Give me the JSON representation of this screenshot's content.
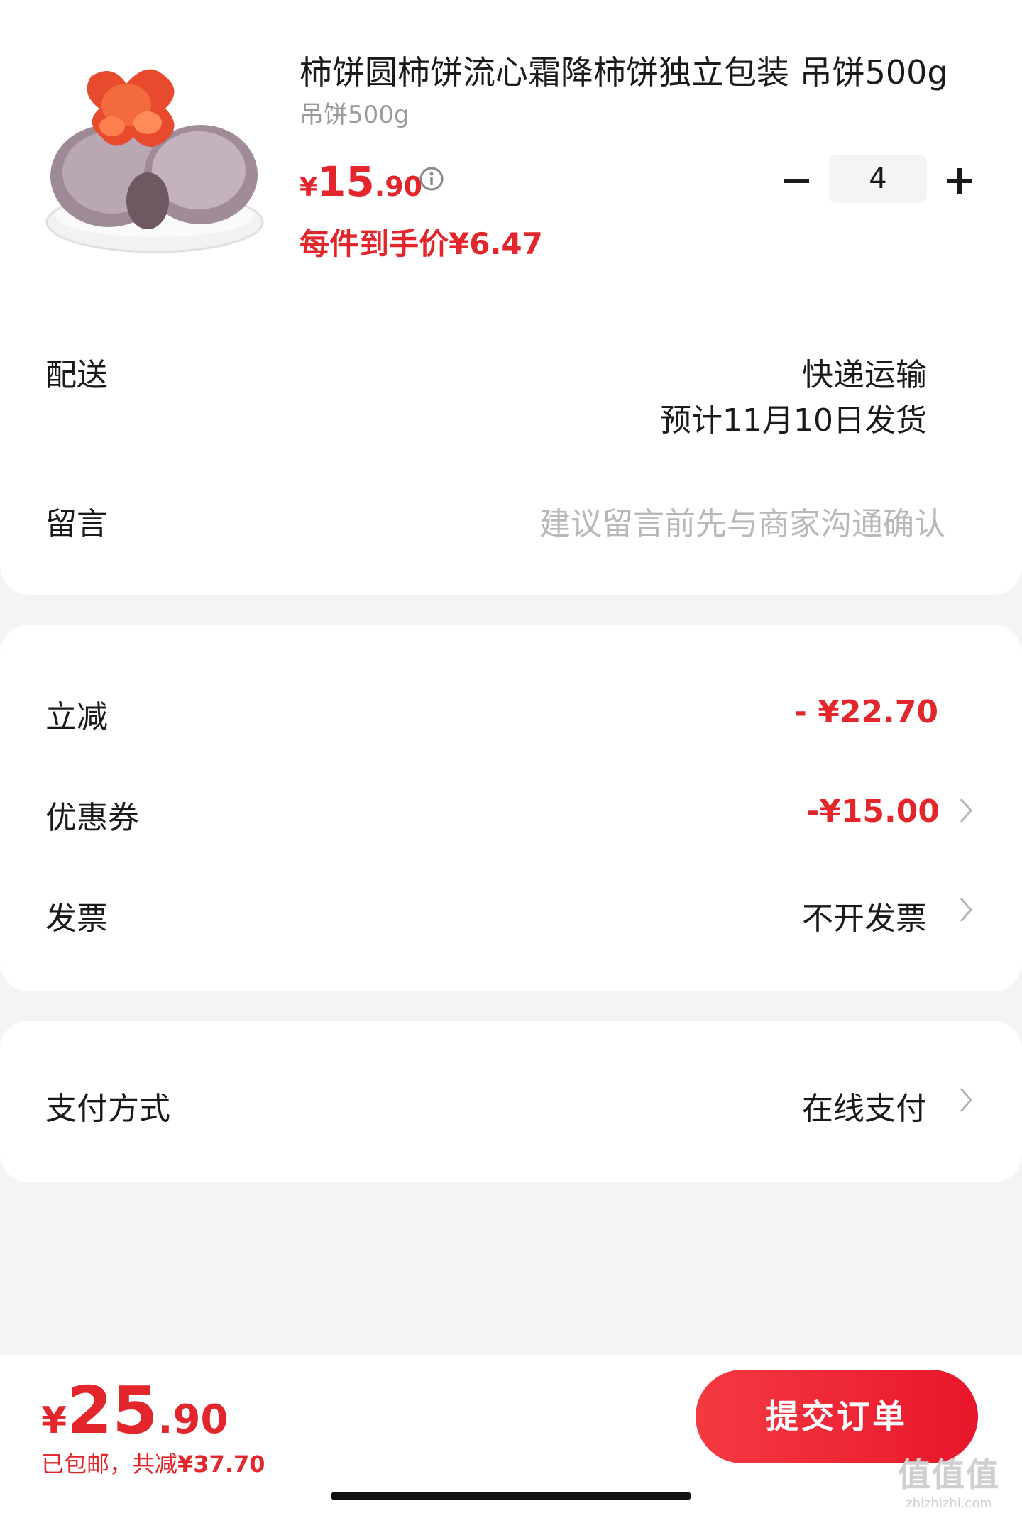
{
  "product": {
    "title": "柿饼圆柿饼流心霜降柿饼独立包装 吊饼500g",
    "spec": "吊饼500g",
    "price_yen": "¥",
    "price_int": "15",
    "price_dec": ".90",
    "unit_price_label": "每件到手价¥6.47",
    "quantity": "4"
  },
  "delivery": {
    "label": "配送",
    "method": "快递运输",
    "eta": "预计11月10日发货"
  },
  "message": {
    "label": "留言",
    "placeholder": "建议留言前先与商家沟通确认"
  },
  "discounts": {
    "instant_label": "立减",
    "instant_value": "- ¥22.70",
    "coupon_label": "优惠券",
    "coupon_value": "-¥15.00",
    "invoice_label": "发票",
    "invoice_value": "不开发票"
  },
  "payment": {
    "label": "支付方式",
    "value": "在线支付"
  },
  "footer": {
    "total_yen": "¥",
    "total_int": "25",
    "total_dec": ".90",
    "note_prefix": "已包邮，共减",
    "note_amount": "¥37.70",
    "submit_label": "提交订单"
  },
  "watermark": {
    "glyphs": "值值值",
    "url": "zhizhizhi.com"
  },
  "colors": {
    "accent": "#e3262b",
    "background": "#f4f4f4",
    "card": "#ffffff"
  }
}
